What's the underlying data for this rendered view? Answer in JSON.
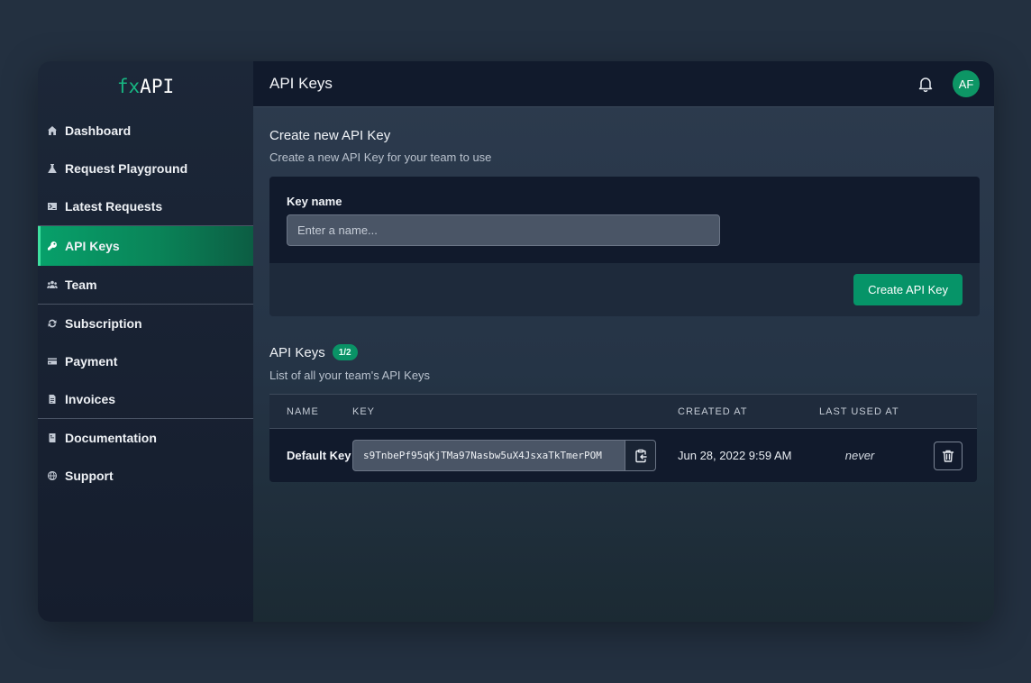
{
  "logo": {
    "prefix": "fx",
    "suffix": "API"
  },
  "sidebar": {
    "items": [
      {
        "label": "Dashboard",
        "icon": "home-icon"
      },
      {
        "label": "Request Playground",
        "icon": "flask-icon"
      },
      {
        "label": "Latest Requests",
        "icon": "terminal-icon"
      },
      {
        "label": "API Keys",
        "icon": "key-icon",
        "active": true
      },
      {
        "label": "Team",
        "icon": "users-icon"
      },
      {
        "label": "Subscription",
        "icon": "refresh-icon"
      },
      {
        "label": "Payment",
        "icon": "credit-card-icon"
      },
      {
        "label": "Invoices",
        "icon": "document-icon"
      },
      {
        "label": "Documentation",
        "icon": "book-icon"
      },
      {
        "label": "Support",
        "icon": "globe-icon"
      }
    ]
  },
  "header": {
    "title": "API Keys",
    "avatar_initials": "AF"
  },
  "create": {
    "title": "Create new API Key",
    "subtitle": "Create a new API Key for your team to use",
    "field_label": "Key name",
    "placeholder": "Enter a name...",
    "button_label": "Create API Key"
  },
  "keys": {
    "title": "API Keys",
    "count": "1/2",
    "subtitle": "List of all your team's API Keys",
    "columns": [
      "NAME",
      "KEY",
      "CREATED AT",
      "LAST USED AT"
    ],
    "rows": [
      {
        "name": "Default Key",
        "key": "s9TnbePf95qKjTMa97Nasbw5uX4JsxaTkTmerPOM",
        "created_at": "Jun 28, 2022 9:59 AM",
        "last_used": "never"
      }
    ]
  },
  "colors": {
    "accent": "#069468",
    "sidebar_bg": "#1c2738",
    "topbar_bg": "#111a2c",
    "page_bg": "#233040"
  }
}
